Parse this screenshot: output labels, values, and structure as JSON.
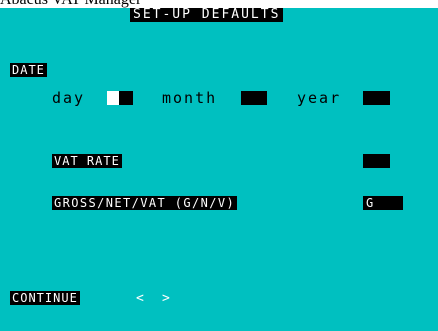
{
  "window": {
    "title": "Abacus VAT Manager"
  },
  "header": {
    "title": "SET-UP DEFAULTS"
  },
  "date": {
    "label": "DATE",
    "day_label": "day",
    "month_label": "month",
    "year_label": "year"
  },
  "vat": {
    "label": "VAT RATE",
    "value": ""
  },
  "gnv": {
    "label": "GROSS/NET/VAT (G/N/V)",
    "value": "G"
  },
  "footer": {
    "continue_label": "CONTINUE",
    "prev_label": "<",
    "next_label": ">"
  },
  "colors": {
    "screen_bg": "#00c0c0",
    "inverse_bg": "#000000",
    "inverse_fg": "#ffffff"
  }
}
